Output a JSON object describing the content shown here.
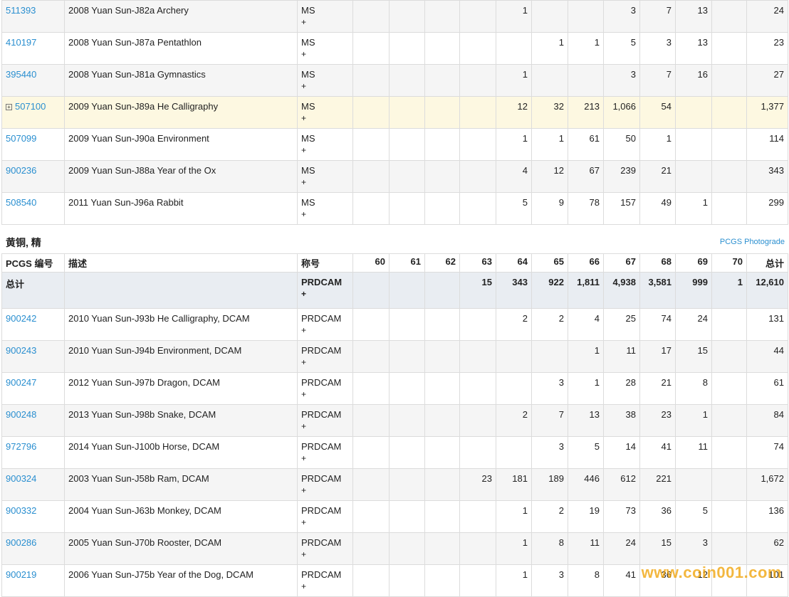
{
  "top_rows": [
    {
      "id": "511393",
      "desc": "2008 Yuan Sun-J82a Archery",
      "des": "MS",
      "plus": "+",
      "cells": [
        "",
        "",
        "",
        "",
        "1",
        "",
        "",
        "3",
        "7",
        "13",
        "",
        "24"
      ],
      "bg": "g",
      "expand": false
    },
    {
      "id": "410197",
      "desc": "2008 Yuan Sun-J87a Pentathlon",
      "des": "MS",
      "plus": "+",
      "cells": [
        "",
        "",
        "",
        "",
        "",
        "1",
        "1",
        "5",
        "3",
        "13",
        "",
        "23"
      ],
      "bg": "w",
      "expand": false
    },
    {
      "id": "395440",
      "desc": "2008 Yuan Sun-J81a Gymnastics",
      "des": "MS",
      "plus": "+",
      "cells": [
        "",
        "",
        "",
        "",
        "1",
        "",
        "",
        "3",
        "7",
        "16",
        "",
        "27"
      ],
      "bg": "g",
      "expand": false
    },
    {
      "id": "507100",
      "desc": "2009 Yuan Sun-J89a He Calligraphy",
      "des": "MS",
      "plus": "+",
      "cells": [
        "",
        "",
        "",
        "",
        "12",
        "32",
        "213",
        "1,066",
        "54",
        "",
        "",
        "1,377"
      ],
      "bg": "hl",
      "expand": true
    },
    {
      "id": "507099",
      "desc": "2009 Yuan Sun-J90a Environment",
      "des": "MS",
      "plus": "+",
      "cells": [
        "",
        "",
        "",
        "",
        "1",
        "1",
        "61",
        "50",
        "1",
        "",
        "",
        "114"
      ],
      "bg": "w",
      "expand": false
    },
    {
      "id": "900236",
      "desc": "2009 Yuan Sun-J88a Year of the Ox",
      "des": "MS",
      "plus": "+",
      "cells": [
        "",
        "",
        "",
        "",
        "4",
        "12",
        "67",
        "239",
        "21",
        "",
        "",
        "343"
      ],
      "bg": "g",
      "expand": false
    },
    {
      "id": "508540",
      "desc": "2011 Yuan Sun-J96a Rabbit",
      "des": "MS",
      "plus": "+",
      "cells": [
        "",
        "",
        "",
        "",
        "5",
        "9",
        "78",
        "157",
        "49",
        "1",
        "",
        "299"
      ],
      "bg": "w",
      "expand": false
    }
  ],
  "section": {
    "title": "黄铜, 精",
    "photograde_link": "PCGS Photograde",
    "headers": [
      "PCGS 编号",
      "描述",
      "称号",
      "60",
      "61",
      "62",
      "63",
      "64",
      "65",
      "66",
      "67",
      "68",
      "69",
      "70",
      "总计"
    ],
    "total": {
      "label": "总计",
      "des": "PRDCAM",
      "plus": "+",
      "cells": [
        "",
        "",
        "",
        "15",
        "343",
        "922",
        "1,811",
        "4,938",
        "3,581",
        "999",
        "1",
        "12,610"
      ]
    },
    "rows": [
      {
        "id": "900242",
        "desc": "2010 Yuan Sun-J93b He Calligraphy, DCAM",
        "des": "PRDCAM",
        "plus": "+",
        "cells": [
          "",
          "",
          "",
          "",
          "2",
          "2",
          "4",
          "25",
          "74",
          "24",
          "",
          "131"
        ],
        "bg": "w"
      },
      {
        "id": "900243",
        "desc": "2010 Yuan Sun-J94b Environment, DCAM",
        "des": "PRDCAM",
        "plus": "+",
        "cells": [
          "",
          "",
          "",
          "",
          "",
          "",
          "1",
          "11",
          "17",
          "15",
          "",
          "44"
        ],
        "bg": "g"
      },
      {
        "id": "900247",
        "desc": "2012 Yuan Sun-J97b Dragon, DCAM",
        "des": "PRDCAM",
        "plus": "+",
        "cells": [
          "",
          "",
          "",
          "",
          "",
          "3",
          "1",
          "28",
          "21",
          "8",
          "",
          "61"
        ],
        "bg": "w"
      },
      {
        "id": "900248",
        "desc": "2013 Yuan Sun-J98b Snake, DCAM",
        "des": "PRDCAM",
        "plus": "+",
        "cells": [
          "",
          "",
          "",
          "",
          "2",
          "7",
          "13",
          "38",
          "23",
          "1",
          "",
          "84"
        ],
        "bg": "g"
      },
      {
        "id": "972796",
        "desc": "2014 Yuan Sun-J100b Horse, DCAM",
        "des": "PRDCAM",
        "plus": "+",
        "cells": [
          "",
          "",
          "",
          "",
          "",
          "3",
          "5",
          "14",
          "41",
          "11",
          "",
          "74"
        ],
        "bg": "w"
      },
      {
        "id": "900324",
        "desc": "2003 Yuan Sun-J58b Ram, DCAM",
        "des": "PRDCAM",
        "plus": "+",
        "cells": [
          "",
          "",
          "",
          "23",
          "181",
          "189",
          "446",
          "612",
          "221",
          "",
          "",
          "1,672"
        ],
        "bg": "g"
      },
      {
        "id": "900332",
        "desc": "2004 Yuan Sun-J63b Monkey, DCAM",
        "des": "PRDCAM",
        "plus": "+",
        "cells": [
          "",
          "",
          "",
          "",
          "1",
          "2",
          "19",
          "73",
          "36",
          "5",
          "",
          "136"
        ],
        "bg": "w"
      },
      {
        "id": "900286",
        "desc": "2005 Yuan Sun-J70b Rooster, DCAM",
        "des": "PRDCAM",
        "plus": "+",
        "cells": [
          "",
          "",
          "",
          "",
          "1",
          "8",
          "11",
          "24",
          "15",
          "3",
          "",
          "62"
        ],
        "bg": "g"
      },
      {
        "id": "900219",
        "desc": "2006 Yuan Sun-J75b Year of the Dog, DCAM",
        "des": "PRDCAM",
        "plus": "+",
        "cells": [
          "",
          "",
          "",
          "",
          "1",
          "3",
          "8",
          "41",
          "36",
          "12",
          "",
          "101"
        ],
        "bg": "w"
      }
    ]
  },
  "watermark": "www.coin001.com"
}
